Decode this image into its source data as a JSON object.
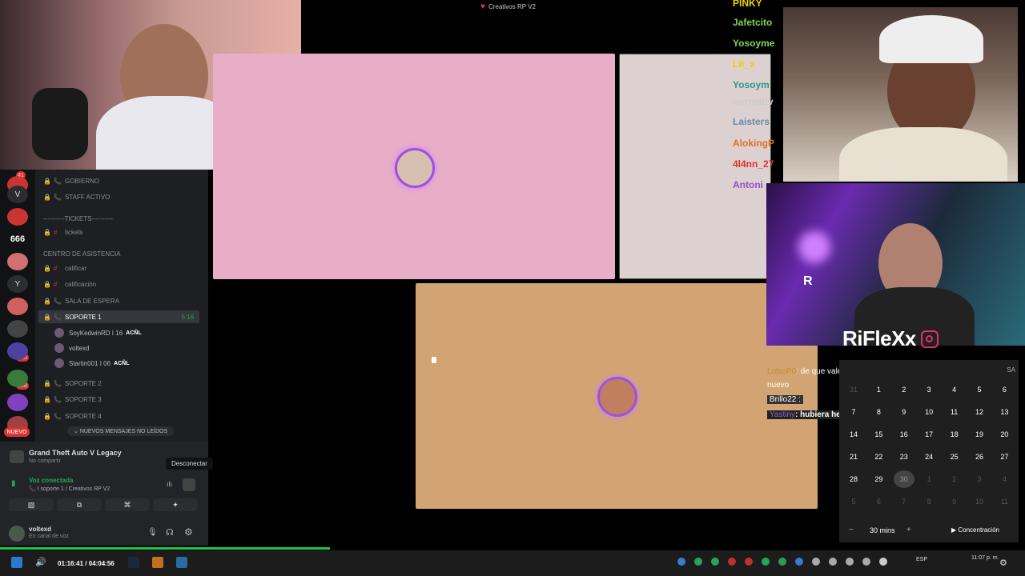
{
  "stage": {
    "title": "Creativos RP V2",
    "tile_colors": {
      "a": "#e8aec8",
      "b": "#ddd0d0",
      "c": "#d3a473"
    }
  },
  "top_chat": {
    "names": [
      {
        "text": "PINKY",
        "color": "#f0d000"
      },
      {
        "text": "Jafetcito",
        "color": "#7fd65a"
      },
      {
        "text": "Yosoyme",
        "color": "#7fd65a"
      },
      {
        "text": "Lit_x",
        "color": "#f0d000"
      },
      {
        "text": "Yosoym",
        "color": "#2a9a8a"
      },
      {
        "text": "normativ",
        "color": "#cccccc"
      },
      {
        "text": "Laisters",
        "color": "#6a8ab0"
      },
      {
        "text": "AlokingP",
        "color": "#e07020"
      },
      {
        "text": "4l4nn_27",
        "color": "#e03030"
      },
      {
        "text": "Antoni",
        "color": "#9050d0"
      }
    ]
  },
  "streamer_overlay": {
    "brand": "RiFleXx"
  },
  "stream_chat": {
    "line1_user": "LolsoP0",
    "line1_text": ": de que vale acordarte de lo civil si estas como",
    "line1_cont": "nuevo",
    "line2_user": "Brillo22 :",
    "line3_user": "Yastiny",
    "line3_text": ": hubiera hecho lo mismo real"
  },
  "discord": {
    "servers": [
      "41",
      "666",
      "413",
      "208"
    ],
    "new_badge": "NUEVO",
    "channels": [
      {
        "name": "GOBIERNO",
        "type": "lock-voice"
      },
      {
        "name": "STAFF ACTIVO",
        "type": "lock-voice"
      },
      {
        "name": "----------TICKETS----------",
        "type": "category"
      },
      {
        "name": "tickets",
        "type": "text"
      },
      {
        "name": "CENTRO DE ASISTENCIA",
        "type": "category"
      },
      {
        "name": "calificar",
        "type": "text"
      },
      {
        "name": "calificación",
        "type": "text"
      },
      {
        "name": "SALA DE ESPERA",
        "type": "voice"
      },
      {
        "name": "SOPORTE 1",
        "type": "voice-active",
        "time": "5:16"
      },
      {
        "name": "SOPORTE 2",
        "type": "voice"
      },
      {
        "name": "SOPORTE 3",
        "type": "voice"
      },
      {
        "name": "SOPORTE 4",
        "type": "voice"
      }
    ],
    "voice_users": [
      {
        "name": "SoyKedwinRD I 16",
        "badge": "ACÑL"
      },
      {
        "name": "voltexd",
        "badge": ""
      },
      {
        "name": "Startin001 I 06",
        "badge": "ACÑL"
      }
    ],
    "new_messages": "NUEVOS MENSAJES NO LEÍDOS",
    "activity_game": "Grand Theft Auto V Legacy",
    "activity_sub": "No compartir",
    "tooltip": "Desconectar",
    "voice_status": "Voz conectada",
    "voice_channel": "I soporte 1 / Creativos RP V2",
    "username": "voltexd",
    "user_status": "En canal de voz"
  },
  "calendar": {
    "header": "SA",
    "rows": [
      [
        "31",
        "1",
        "2",
        "3",
        "4",
        "5",
        "6"
      ],
      [
        "7",
        "8",
        "9",
        "10",
        "11",
        "12",
        "13"
      ],
      [
        "14",
        "15",
        "16",
        "17",
        "18",
        "19",
        "20"
      ],
      [
        "21",
        "22",
        "23",
        "24",
        "25",
        "26",
        "27"
      ],
      [
        "28",
        "29",
        "30",
        "1",
        "2",
        "3",
        "4"
      ],
      [
        "5",
        "6",
        "7",
        "8",
        "9",
        "10",
        "11"
      ]
    ],
    "today": "30",
    "focus_time": "30 mins",
    "focus_label": "Concentración"
  },
  "taskbar": {
    "timer": "01:16:41 / 04:04:56",
    "progress": 0.322,
    "time": "11:07 p. m.",
    "lang": "ESP"
  }
}
